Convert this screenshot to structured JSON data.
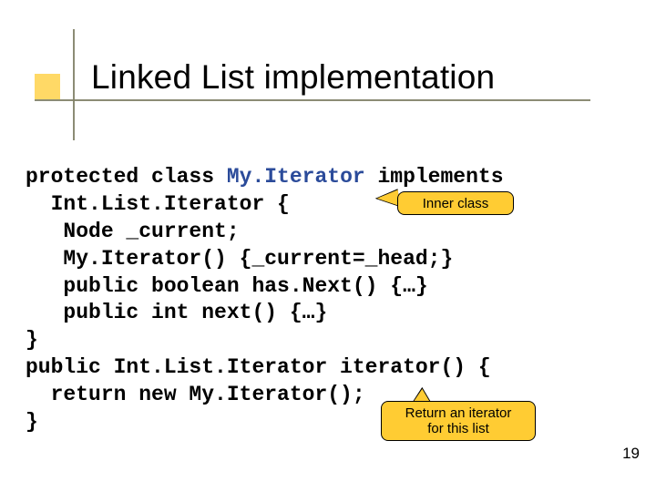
{
  "title": "Linked List implementation",
  "code": {
    "l1a": "protected class ",
    "l1b": "My.Iterator",
    "l1c": " implements",
    "l2": "  Int.List.Iterator {",
    "l3": "   Node _current;",
    "l4": "   My.Iterator() {_current=_head;}",
    "l5": "   public boolean has.Next() {…}",
    "l6": "   public int next() {…}",
    "l7": "}",
    "l8": "public Int.List.Iterator iterator() {",
    "l9": "  return new My.Iterator();",
    "l10": "}"
  },
  "callouts": {
    "inner": "Inner class",
    "iterator": "Return an iterator\nfor this list"
  },
  "page_number": "19"
}
